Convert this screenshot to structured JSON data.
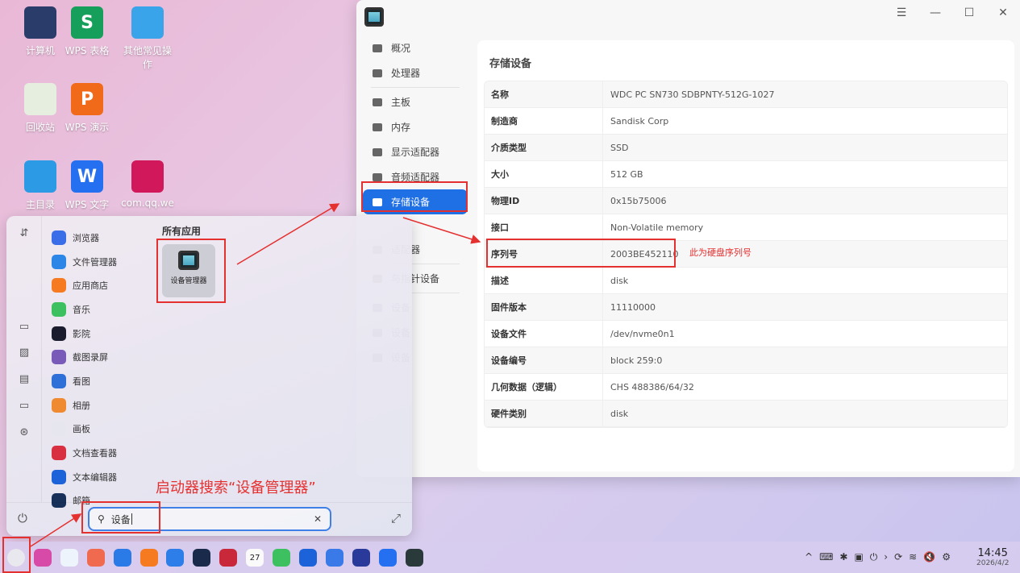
{
  "desktop": {
    "icons": [
      {
        "label": "计算机",
        "color": "#2a3d6a"
      },
      {
        "label": "WPS 表格",
        "glyph": "S",
        "color": "#169f5a"
      },
      {
        "label": "其他常见操作",
        "color": "#3aa4ea"
      },
      {
        "label": "回收站",
        "color": "#e6eee0"
      },
      {
        "label": "WPS 演示",
        "glyph": "P",
        "color": "#f06a1a"
      },
      {
        "label": "主目录",
        "color": "#2d9ae6"
      },
      {
        "label": "WPS 文字",
        "glyph": "W",
        "color": "#2470f0"
      },
      {
        "label": "com.qq.we",
        "color": "#d0185a"
      }
    ]
  },
  "window": {
    "controls": {
      "menu": "☰",
      "minimize": "—",
      "maximize": "☐",
      "close": "✕"
    },
    "sidebar": [
      {
        "label": "概况"
      },
      {
        "label": "处理器"
      },
      {
        "label": "主板"
      },
      {
        "label": "内存"
      },
      {
        "label": "显示适配器"
      },
      {
        "label": "音频适配器"
      },
      {
        "label": "存储设备",
        "active": true
      },
      {
        "label": "适配器"
      },
      {
        "label": "与指针设备"
      },
      {
        "label": "设备"
      },
      {
        "label": "设备"
      },
      {
        "label": "设备"
      }
    ],
    "section_title": "存储设备",
    "rows": [
      {
        "key": "名称",
        "value": "WDC PC SN730 SDBPNTY-512G-1027"
      },
      {
        "key": "制造商",
        "value": "Sandisk Corp"
      },
      {
        "key": "介质类型",
        "value": "SSD"
      },
      {
        "key": "大小",
        "value": "512 GB"
      },
      {
        "key": "物理ID",
        "value": "0x15b75006"
      },
      {
        "key": "接口",
        "value": "Non-Volatile memory"
      },
      {
        "key": "序列号",
        "value": "2003BE452110"
      },
      {
        "key": "描述",
        "value": "disk"
      },
      {
        "key": "固件版本",
        "value": "11110000"
      },
      {
        "key": "设备文件",
        "value": "/dev/nvme0n1"
      },
      {
        "key": "设备编号",
        "value": "block 259:0"
      },
      {
        "key": "几何数据（逻辑）",
        "value": "CHS 488386/64/32"
      },
      {
        "key": "硬件类别",
        "value": "disk"
      }
    ]
  },
  "launcher": {
    "sort_icon": "⇵",
    "apps": [
      {
        "label": "浏览器",
        "color": "#3a6ee8"
      },
      {
        "label": "文件管理器",
        "color": "#2b86e8"
      },
      {
        "label": "应用商店",
        "color": "#f57a20"
      },
      {
        "label": "音乐",
        "color": "#3cc060"
      },
      {
        "label": "影院",
        "color": "#1b1b2e"
      },
      {
        "label": "截图录屏",
        "color": "#7a5ab8"
      },
      {
        "label": "看图",
        "color": "#2f6fd8"
      },
      {
        "label": "相册",
        "color": "#f08a30"
      },
      {
        "label": "画板",
        "color": "#e6e6ee"
      },
      {
        "label": "文档查看器",
        "color": "#d83040"
      },
      {
        "label": "文本编辑器",
        "color": "#1c62d8"
      },
      {
        "label": "邮箱",
        "color": "#17305a"
      }
    ],
    "section_title": "所有应用",
    "result": "设备管理器",
    "search_value": "设备",
    "clear": "✕",
    "expand": "⤢",
    "power": "⏻"
  },
  "annotations": {
    "launcher_note": "启动器搜索“设备管理器”",
    "serial_note": "此为硬盘序列号"
  },
  "taskbar": {
    "apps": [
      "launcher",
      "assistant",
      "search",
      "control-center",
      "file-manager",
      "app-store",
      "browser",
      "editor",
      "terminal",
      "calendar",
      "music",
      "text-editor",
      "calculator",
      "settings",
      "wps-writer",
      "device-manager"
    ],
    "calendar_day": "27",
    "tray": [
      "^",
      "⌨",
      "✱",
      "▣",
      "⏻",
      "›",
      "⟳",
      "≋",
      "🔇",
      "⚙"
    ],
    "time": "14:45",
    "date": "2026/4/2"
  },
  "colors": {
    "accent": "#1f6fe5",
    "annotation": "#e53030"
  }
}
